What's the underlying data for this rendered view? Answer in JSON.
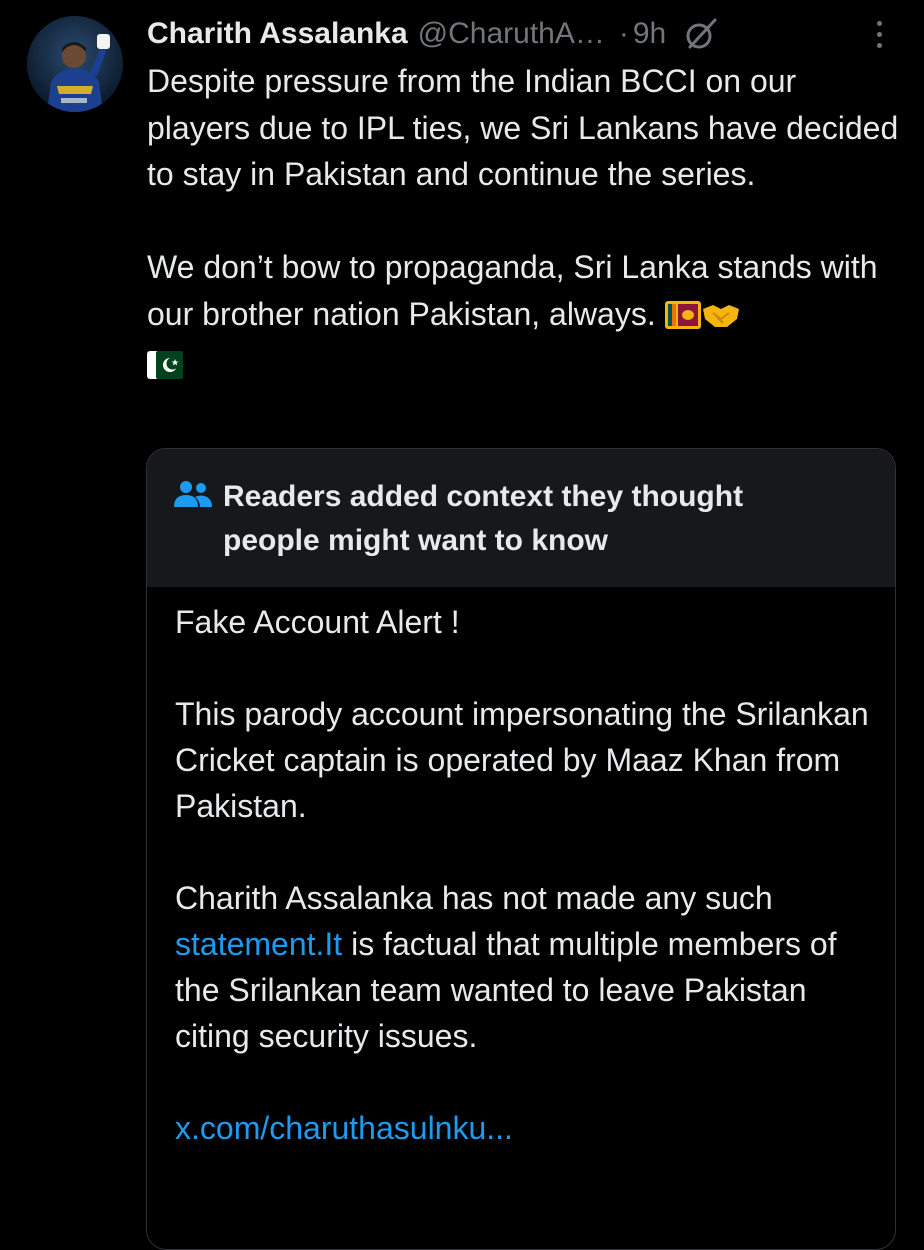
{
  "tweet": {
    "author_name": "Charith Assalanka",
    "author_handle": "@CharuthA…",
    "separator": "·",
    "time": "9h",
    "paragraph_1": "Despite pressure from the Indian BCCI on our players due to IPL ties, we Sri Lankans have decided to stay in Pakistan and continue the series.",
    "paragraph_2": "We don’t bow to propaganda, Sri Lanka stands with our brother nation Pakistan, always.",
    "emojis": [
      "sri-lanka-flag",
      "handshake",
      "pakistan-flag"
    ]
  },
  "community_note": {
    "title": "Readers added context they thought people might want to know",
    "line_1": "Fake Account Alert !",
    "paragraph_2": "This parody account impersonating the Srilankan Cricket captain is operated by Maaz Khan from Pakistan.",
    "paragraph_3_before_link": "Charith Assalanka has not made any such ",
    "paragraph_3_link": "statement.It",
    "paragraph_3_after_link": " is factual that multiple members of the Srilankan team wanted to leave Pakistan citing security issues.",
    "source_link": "x.com/charuthasulnku..."
  },
  "icons": {
    "grok": "grok-icon",
    "more": "more-icon",
    "people": "people-icon"
  },
  "colors": {
    "background": "#000000",
    "text_primary": "#e7e9ea",
    "text_secondary": "#71767b",
    "link": "#1d9bf0",
    "note_header_bg": "#16181c",
    "border": "#2f3336"
  }
}
